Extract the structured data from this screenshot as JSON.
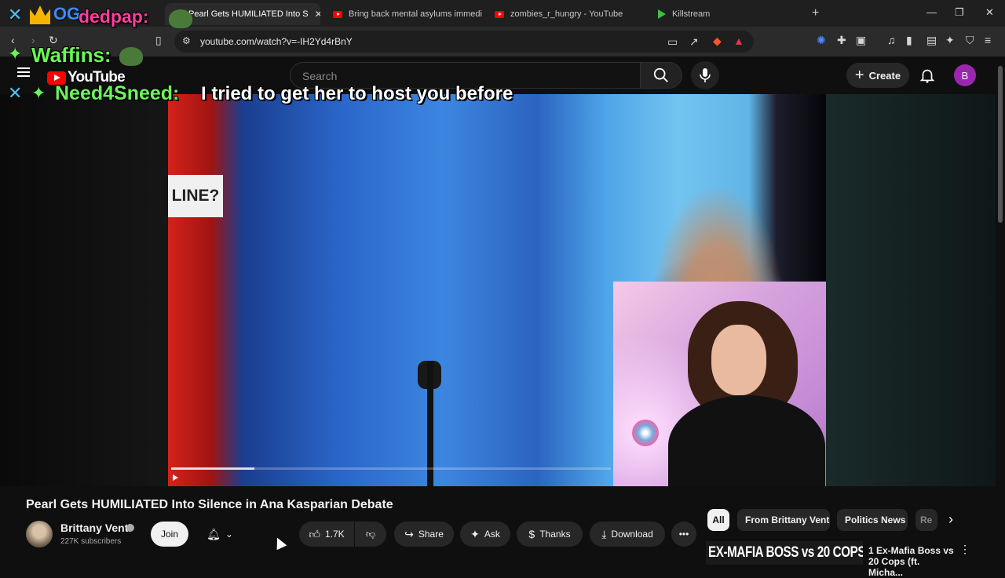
{
  "browser": {
    "tabs": [
      {
        "label": "Pearl Gets HUMILIATED Into S",
        "active": true
      },
      {
        "label": "Bring back mental asylums immediat",
        "active": false
      },
      {
        "label": "zombies_r_hungry - YouTube",
        "active": false
      },
      {
        "label": "Killstream",
        "active": false
      }
    ],
    "new_tab": "+",
    "window_controls": {
      "minimize": "—",
      "restore": "❐",
      "close": "✕"
    },
    "url": "youtube.com/watch?v=-IH2Yd4rBnY"
  },
  "youtube": {
    "logo": "YouTube",
    "search_placeholder": "Search",
    "create_label": "Create",
    "avatar_letter": "B"
  },
  "chat_overlay": {
    "line1_user": "dedpap:",
    "line2_user": "Waffins:",
    "line3_user": "Need4Sneed:",
    "line3_message": "I tried to get her to host you before",
    "og_badge": "OG"
  },
  "video": {
    "on_screen_sign": "LINE?",
    "progress_fraction": 0.19
  },
  "below_video": {
    "title": "Pearl Gets HUMILIATED Into Silence in Ana Kasparian Debate",
    "channel_name": "Brittany Venti",
    "subscribers": "227K subscribers",
    "join_label": "Join",
    "like_count": "1.7K",
    "share_label": "Share",
    "ask_label": "Ask",
    "thanks_label": "Thanks",
    "download_label": "Download"
  },
  "chips": [
    "All",
    "From Brittany Venti",
    "Politics News",
    "Re"
  ],
  "recommended": {
    "thumb_text": "EX-MAFIA BOSS vs 20 COPS",
    "title": "1 Ex-Mafia Boss vs 20 Cops (ft. Micha..."
  },
  "colors": {
    "yt_red": "#ff0000",
    "background": "#0f0f0f",
    "chat_pink": "#ff3ea0",
    "chat_green": "#6cf55a",
    "avatar_purple": "#9b27b0"
  }
}
